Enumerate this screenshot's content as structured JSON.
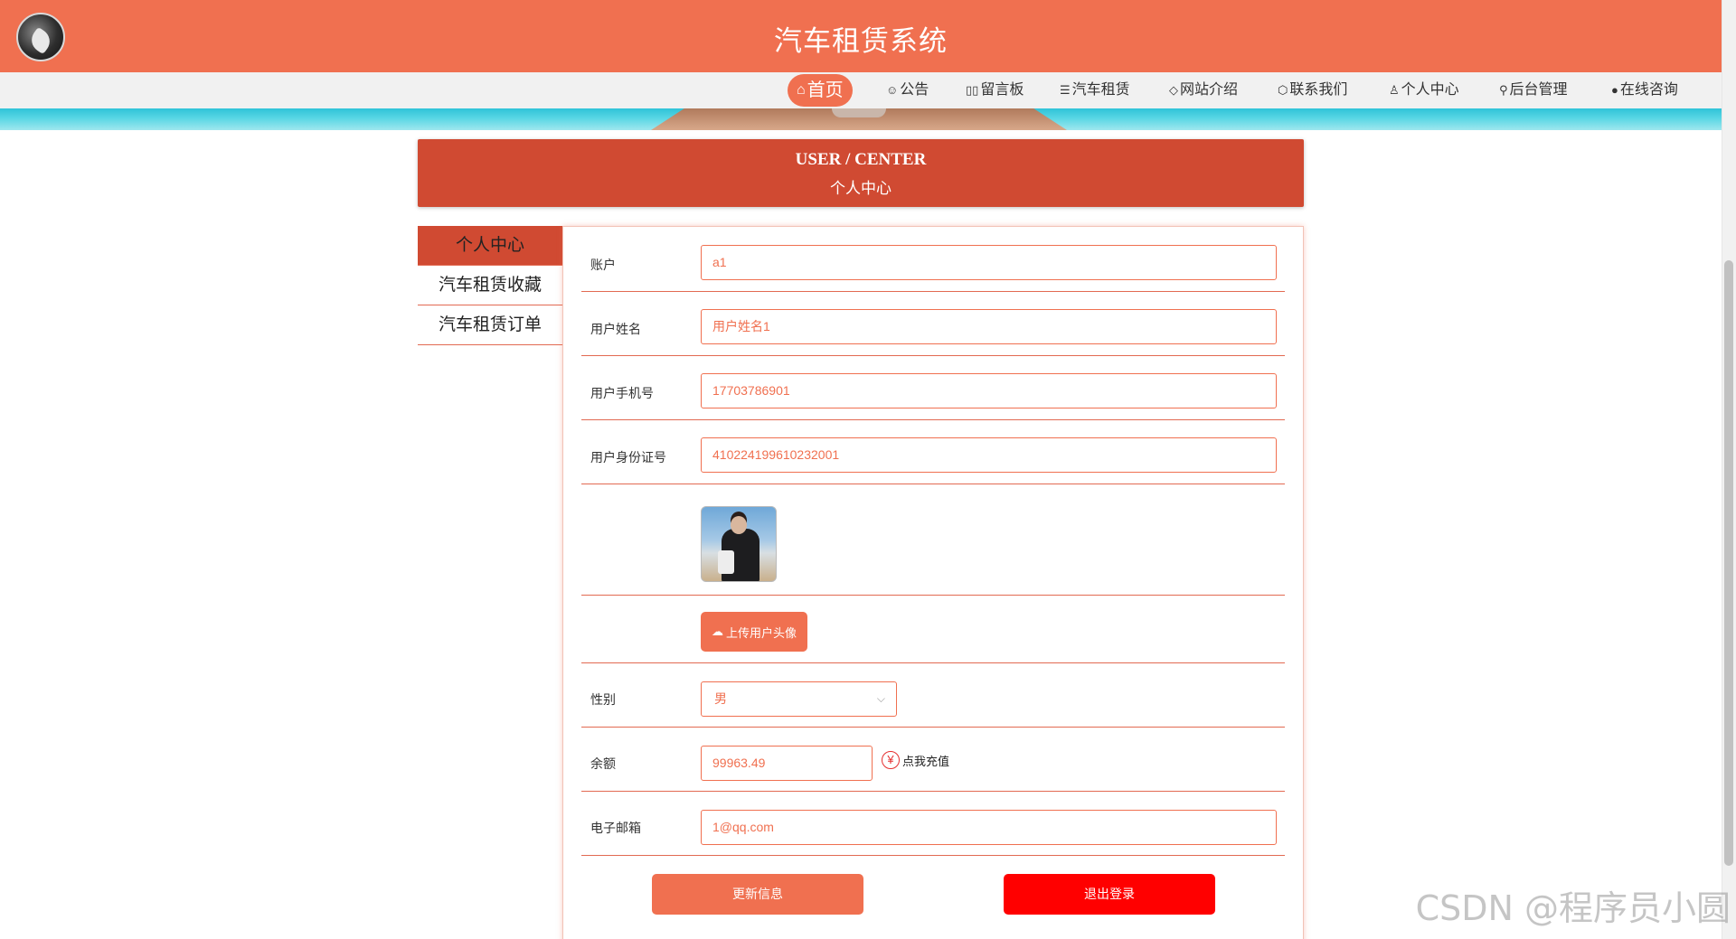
{
  "header": {
    "title": "汽车租赁系统",
    "bg_color": "#f07050"
  },
  "nav": {
    "items": [
      {
        "label": "首页",
        "icon": "home-icon",
        "glyph": "⌂",
        "active": true
      },
      {
        "label": "公告",
        "icon": "announcement-icon",
        "glyph": "☺",
        "active": false
      },
      {
        "label": "留言板",
        "icon": "message-board-icon",
        "glyph": "▯▯",
        "active": false
      },
      {
        "label": "汽车租赁",
        "icon": "layers-icon",
        "glyph": "☰",
        "active": false
      },
      {
        "label": "网站介绍",
        "icon": "tag-icon",
        "glyph": "◇",
        "active": false
      },
      {
        "label": "联系我们",
        "icon": "contact-icon",
        "glyph": "⬡",
        "active": false
      },
      {
        "label": "个人中心",
        "icon": "user-icon",
        "glyph": "♙",
        "active": false
      },
      {
        "label": "后台管理",
        "icon": "link-icon",
        "glyph": "⚲",
        "active": false
      },
      {
        "label": "在线咨询",
        "icon": "chat-icon",
        "glyph": "●",
        "active": false
      }
    ]
  },
  "section_title": {
    "en": "USER / CENTER",
    "cn": "个人中心"
  },
  "sidebar": {
    "items": [
      {
        "label": "个人中心",
        "active": true
      },
      {
        "label": "汽车租赁收藏",
        "active": false
      },
      {
        "label": "汽车租赁订单",
        "active": false
      }
    ]
  },
  "form": {
    "account": {
      "label": "账户",
      "value": "a1"
    },
    "username": {
      "label": "用户姓名",
      "value": "用户姓名1"
    },
    "phone": {
      "label": "用户手机号",
      "value": "17703786901"
    },
    "id_card": {
      "label": "用户身份证号",
      "value": "410224199610232001"
    },
    "upload_label": "上传用户头像",
    "gender": {
      "label": "性别",
      "value": "男"
    },
    "balance": {
      "label": "余额",
      "value": "99963.49",
      "recharge_label": "点我充值"
    },
    "email": {
      "label": "电子邮箱",
      "value": "1@qq.com"
    },
    "update_button": "更新信息",
    "logout_button": "退出登录"
  },
  "colors": {
    "accent": "#f07050",
    "title_bar": "#d04a32",
    "logout": "#ff0000"
  },
  "watermark": "CSDN @程序员小圆"
}
